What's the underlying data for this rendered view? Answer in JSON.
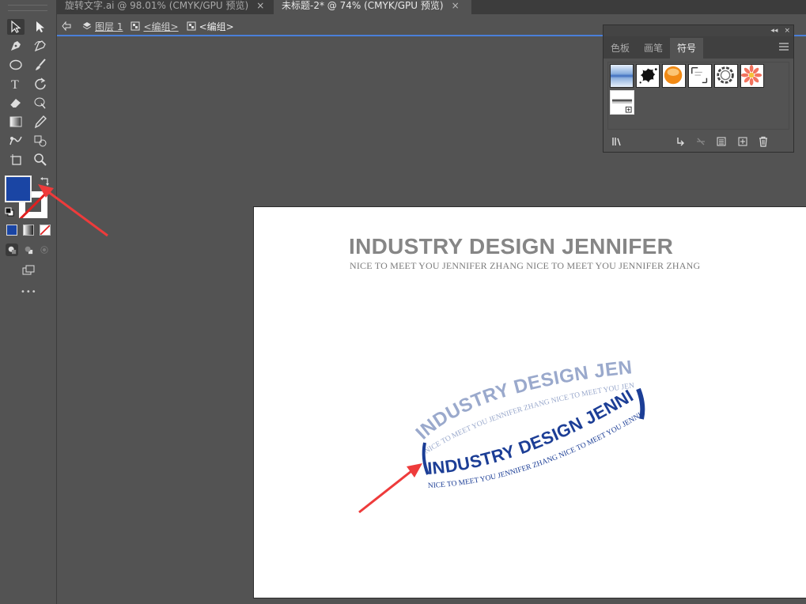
{
  "tabs": [
    {
      "label": "旋转文字.ai @ 98.01% (CMYK/GPU 预览)",
      "active": false
    },
    {
      "label": "未标题-2* @ 74% (CMYK/GPU 预览)",
      "active": true
    }
  ],
  "tab_close_glyph": "×",
  "breadcrumb": {
    "layer": "图层 1",
    "group1": "<编组>",
    "group2": "<编组>"
  },
  "panel": {
    "collapse_glyph": "◂◂",
    "close_glyph": "×",
    "tabs": [
      "色板",
      "画笔",
      "符号"
    ],
    "active_tab": 2
  },
  "artboard": {
    "title": "INDUSTRY DESIGN JENNIFER",
    "subtitle": "NICE TO MEET YOU JENNIFER ZHANG  NICE TO MEET YOU JENNIFER ZHANG",
    "ring_back_big": "INDUSTRY DESIGN JENNIFER",
    "ring_back_small": "NICE TO MEET YOU JENNIFER ZHANG  NICE TO MEET YOU JENNIFER ZHANG",
    "ring_front_big": "INDUSTRY DESIGN JENNIFER",
    "ring_front_small": "NICE TO MEET YOU JENNIFER ZHANG  NICE TO MEET YOU JENNIFER ZHANG"
  },
  "colors": {
    "fill": "#1a45a4",
    "ring_back": "#9aa9cc",
    "ring_front": "#1c3e96",
    "arrow": "#ee3b3b",
    "accent_line": "#4a7fd9"
  },
  "more_tools_glyph": "•••"
}
